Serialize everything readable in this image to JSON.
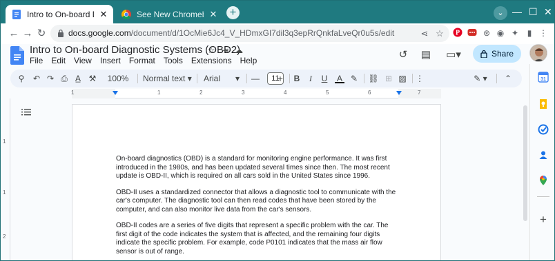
{
  "browser": {
    "tabs": [
      {
        "title": "Intro to On-board Diagnostic Sys",
        "active": true
      },
      {
        "title": "See New Chromebook Updates &",
        "active": false
      }
    ],
    "new_tab": "+",
    "tab_search": "⌄",
    "window_controls": {
      "minimize": "—",
      "maximize": "☐",
      "close": "✕"
    },
    "url_host": "docs.google.com",
    "url_path": "/document/d/1OcMie6Jc4_V_HDmxGI7dil3q3epRrQnkfaLveQr0u5s/edit",
    "colors": {
      "tabstrip": "#1f7a80",
      "pinterest": "#e60023",
      "lastpass": "#d32d27"
    }
  },
  "docs": {
    "title": "Intro to On-board Diagnostic Systems (OBD2)",
    "menu": [
      "File",
      "Edit",
      "View",
      "Insert",
      "Format",
      "Tools",
      "Extensions",
      "Help"
    ],
    "share_label": "Share",
    "toolbar": {
      "zoom": "100%",
      "style": "Normal text",
      "font": "Arial",
      "font_size": "11",
      "minus": "—",
      "plus": "+",
      "bold": "B",
      "italic": "I",
      "underline": "U",
      "text_color_letter": "A"
    },
    "ruler_numbers": [
      "1",
      "1",
      "2",
      "3",
      "4",
      "5",
      "6",
      "7"
    ],
    "vruler_numbers": [
      "1",
      "1",
      "2"
    ],
    "paragraphs": [
      "On-board diagnostics (OBD) is a standard for monitoring engine performance. It was first introduced in the 1980s, and has been updated several times since then. The most recent update is OBD-II, which is required on all cars sold in the United States since 1996.",
      "OBD-II uses a standardized connector that allows a diagnostic tool to communicate with the car's computer. The diagnostic tool can then read codes that have been stored by the computer, and can also monitor live data from the car's sensors.",
      "OBD-II codes are a series of five digits that represent a specific problem with the car. The first digit of the code indicates the system that is affected, and the remaining four digits indicate the specific problem. For example, code P0101 indicates that the mass air flow sensor is out of range."
    ],
    "side_panel_add": "+"
  }
}
